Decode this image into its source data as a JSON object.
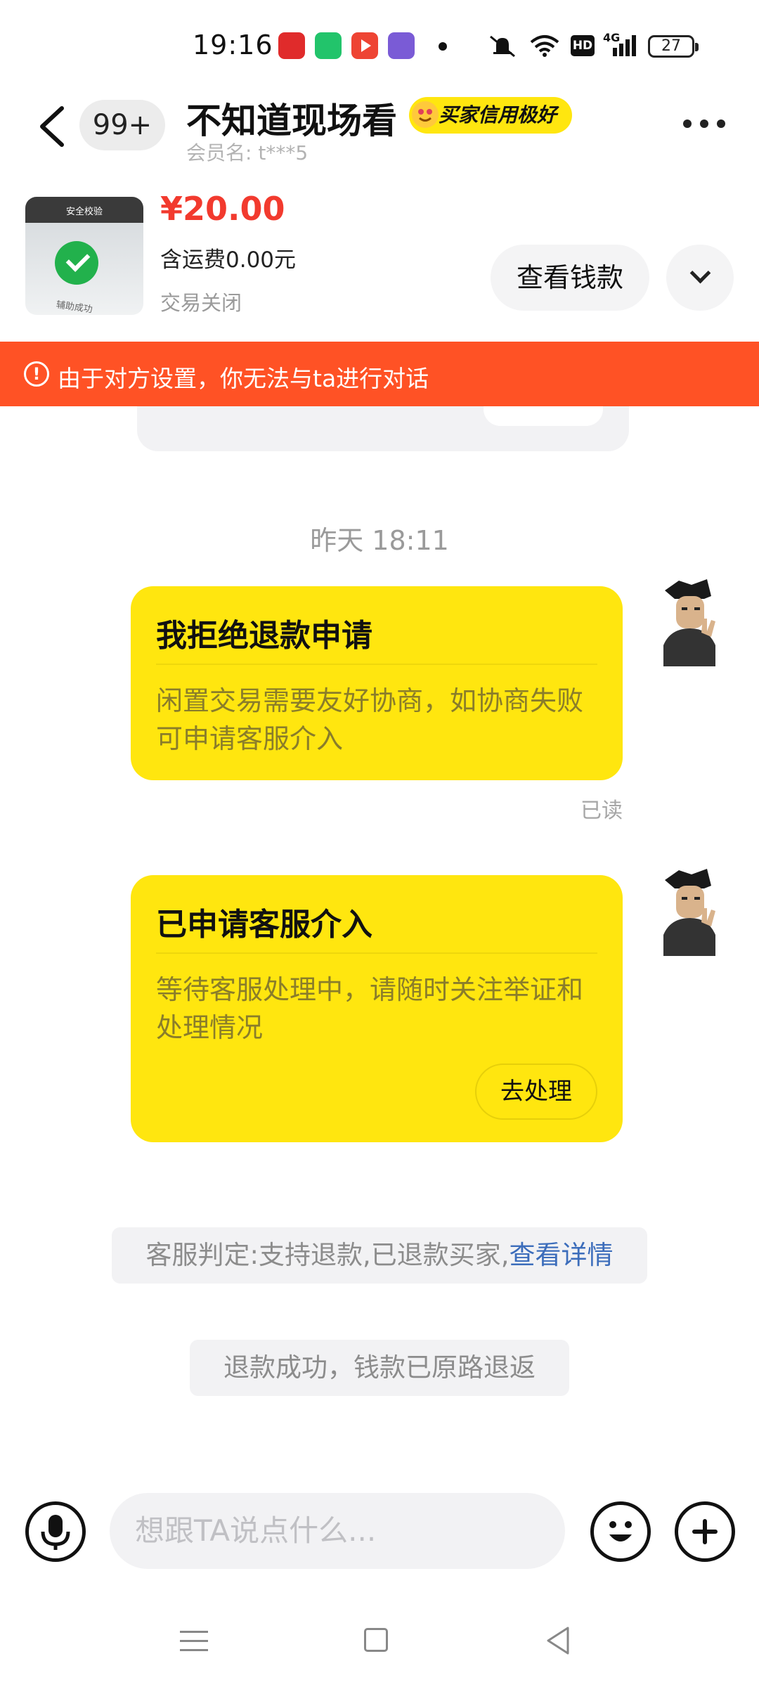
{
  "status_bar": {
    "time": "19:16",
    "battery": "27",
    "network": "4G",
    "hd": "HD",
    "icons": [
      "app-notification-icon",
      "phone-app-icon",
      "video-app-icon",
      "news-app-icon",
      "dot-icon",
      "mute-icon",
      "wifi-icon",
      "hd-icon",
      "signal-icon",
      "battery-icon"
    ]
  },
  "header": {
    "unread_count": "99+",
    "title": "不知道现场看",
    "badge": "买家信用极好",
    "member_label": "会员名:",
    "member_name": "t***5"
  },
  "product": {
    "thumb_top_text": "安全校验",
    "thumb_bottom_text": "辅助成功",
    "price": "¥20.00",
    "shipping": "含运费0.00元",
    "status": "交易关闭",
    "view_money_label": "查看钱款"
  },
  "alert": {
    "text": "由于对方设置，你无法与ta进行对话",
    "icon_glyph": "!"
  },
  "chat": {
    "timestamp": "昨天 18:11",
    "messages": [
      {
        "title": "我拒绝退款申请",
        "body": "闲置交易需要友好协商，如协商失败可申请客服介入",
        "status": "已读"
      },
      {
        "title": "已申请客服介入",
        "body": "等待客服处理中，请随时关注举证和处理情况",
        "action": "去处理"
      }
    ],
    "system_notes": [
      {
        "text": "客服判定:支持退款,已退款买家,",
        "link": "查看详情"
      },
      {
        "text": "退款成功，钱款已原路退返"
      }
    ]
  },
  "input": {
    "placeholder": "想跟TA说点什么..."
  },
  "colors": {
    "accent_yellow": "#ffe60f",
    "alert_orange": "#ff5225",
    "price_red": "#f23a2e",
    "link_blue": "#3c6dbb"
  }
}
